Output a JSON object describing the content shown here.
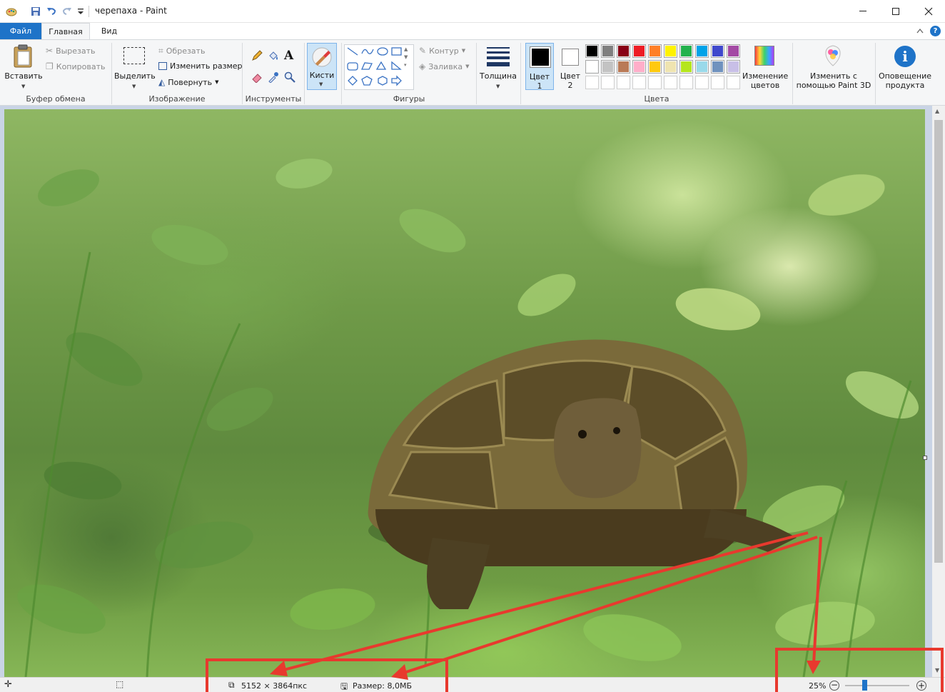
{
  "title": "черепаха - Paint",
  "tabs": {
    "file": "Файл",
    "home": "Главная",
    "view": "Вид"
  },
  "clipboard": {
    "paste": "Вставить",
    "cut": "Вырезать",
    "copy": "Копировать",
    "group": "Буфер обмена"
  },
  "image": {
    "select": "Выделить",
    "crop": "Обрезать",
    "resize": "Изменить размер",
    "rotate": "Повернуть",
    "group": "Изображение"
  },
  "tools": {
    "group": "Инструменты"
  },
  "brushes": {
    "label": "Кисти"
  },
  "shapes": {
    "outline": "Контур",
    "fill": "Заливка",
    "group": "Фигуры"
  },
  "size": {
    "label": "Толщина"
  },
  "colors": {
    "color1_line1": "Цвет",
    "color1_line2": "1",
    "color2_line1": "Цвет",
    "color2_line2": "2",
    "edit_line1": "Изменение",
    "edit_line2": "цветов",
    "group": "Цвета",
    "palette_row1": [
      "#000000",
      "#7f7f7f",
      "#880015",
      "#ed1c24",
      "#ff7f27",
      "#fff200",
      "#22b14c",
      "#00a2e8",
      "#3f48cc",
      "#a349a4"
    ],
    "palette_row2": [
      "#ffffff",
      "#c3c3c3",
      "#b97a57",
      "#ffaec9",
      "#ffc90e",
      "#efe4b0",
      "#b5e61d",
      "#99d9ea",
      "#7092be",
      "#c8bfe7"
    ],
    "primary": "#000000",
    "secondary": "#ffffff"
  },
  "paint3d": {
    "line1": "Изменить с",
    "line2": "помощью Paint 3D"
  },
  "notify": {
    "line1": "Оповещение",
    "line2": "продукта"
  },
  "status": {
    "dimensions": "5152 × 3864пкс",
    "filesize": "Размер: 8,0МБ",
    "zoom": "25%"
  }
}
